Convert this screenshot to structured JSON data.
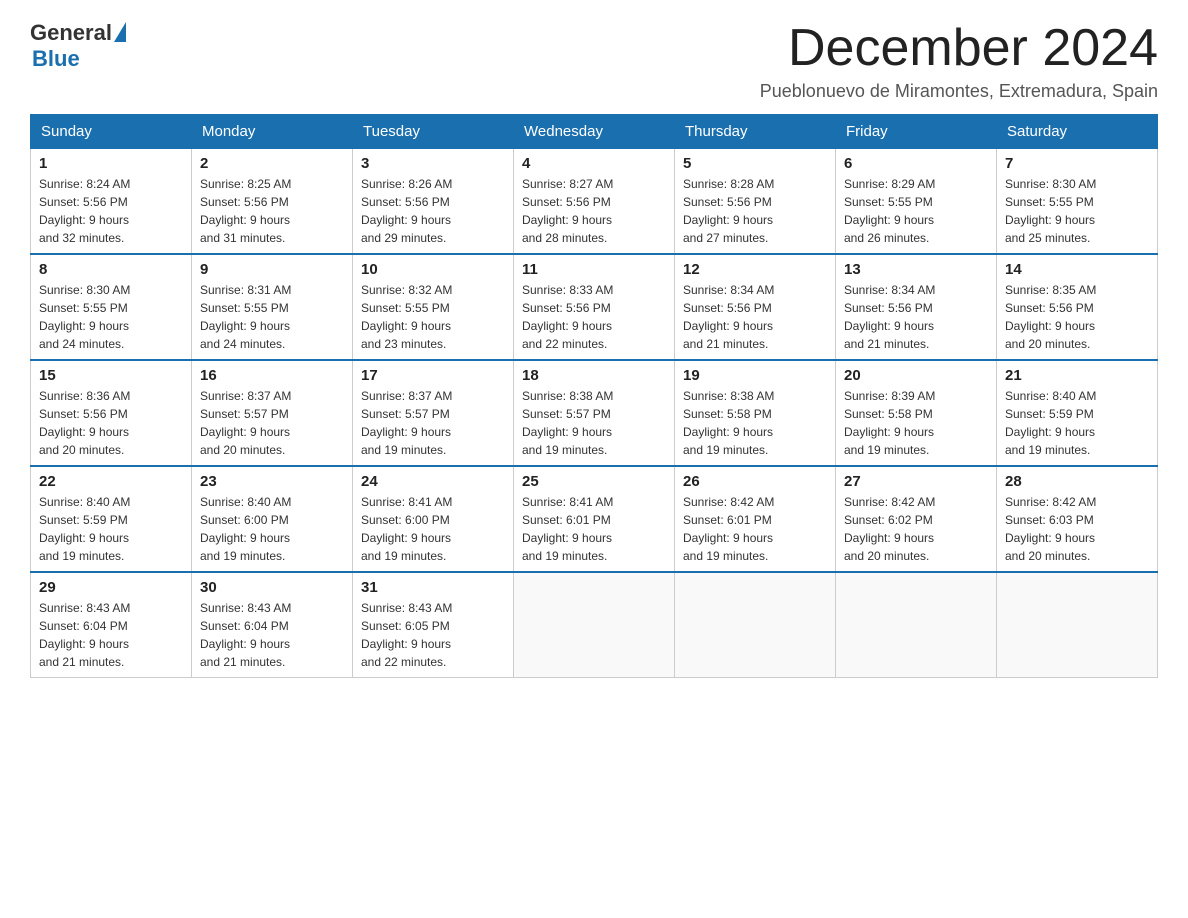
{
  "logo": {
    "general": "General",
    "blue": "Blue"
  },
  "title": "December 2024",
  "subtitle": "Pueblonuevo de Miramontes, Extremadura, Spain",
  "days_of_week": [
    "Sunday",
    "Monday",
    "Tuesday",
    "Wednesday",
    "Thursday",
    "Friday",
    "Saturday"
  ],
  "weeks": [
    [
      {
        "day": "1",
        "sunrise": "8:24 AM",
        "sunset": "5:56 PM",
        "daylight": "9 hours and 32 minutes."
      },
      {
        "day": "2",
        "sunrise": "8:25 AM",
        "sunset": "5:56 PM",
        "daylight": "9 hours and 31 minutes."
      },
      {
        "day": "3",
        "sunrise": "8:26 AM",
        "sunset": "5:56 PM",
        "daylight": "9 hours and 29 minutes."
      },
      {
        "day": "4",
        "sunrise": "8:27 AM",
        "sunset": "5:56 PM",
        "daylight": "9 hours and 28 minutes."
      },
      {
        "day": "5",
        "sunrise": "8:28 AM",
        "sunset": "5:56 PM",
        "daylight": "9 hours and 27 minutes."
      },
      {
        "day": "6",
        "sunrise": "8:29 AM",
        "sunset": "5:55 PM",
        "daylight": "9 hours and 26 minutes."
      },
      {
        "day": "7",
        "sunrise": "8:30 AM",
        "sunset": "5:55 PM",
        "daylight": "9 hours and 25 minutes."
      }
    ],
    [
      {
        "day": "8",
        "sunrise": "8:30 AM",
        "sunset": "5:55 PM",
        "daylight": "9 hours and 24 minutes."
      },
      {
        "day": "9",
        "sunrise": "8:31 AM",
        "sunset": "5:55 PM",
        "daylight": "9 hours and 24 minutes."
      },
      {
        "day": "10",
        "sunrise": "8:32 AM",
        "sunset": "5:55 PM",
        "daylight": "9 hours and 23 minutes."
      },
      {
        "day": "11",
        "sunrise": "8:33 AM",
        "sunset": "5:56 PM",
        "daylight": "9 hours and 22 minutes."
      },
      {
        "day": "12",
        "sunrise": "8:34 AM",
        "sunset": "5:56 PM",
        "daylight": "9 hours and 21 minutes."
      },
      {
        "day": "13",
        "sunrise": "8:34 AM",
        "sunset": "5:56 PM",
        "daylight": "9 hours and 21 minutes."
      },
      {
        "day": "14",
        "sunrise": "8:35 AM",
        "sunset": "5:56 PM",
        "daylight": "9 hours and 20 minutes."
      }
    ],
    [
      {
        "day": "15",
        "sunrise": "8:36 AM",
        "sunset": "5:56 PM",
        "daylight": "9 hours and 20 minutes."
      },
      {
        "day": "16",
        "sunrise": "8:37 AM",
        "sunset": "5:57 PM",
        "daylight": "9 hours and 20 minutes."
      },
      {
        "day": "17",
        "sunrise": "8:37 AM",
        "sunset": "5:57 PM",
        "daylight": "9 hours and 19 minutes."
      },
      {
        "day": "18",
        "sunrise": "8:38 AM",
        "sunset": "5:57 PM",
        "daylight": "9 hours and 19 minutes."
      },
      {
        "day": "19",
        "sunrise": "8:38 AM",
        "sunset": "5:58 PM",
        "daylight": "9 hours and 19 minutes."
      },
      {
        "day": "20",
        "sunrise": "8:39 AM",
        "sunset": "5:58 PM",
        "daylight": "9 hours and 19 minutes."
      },
      {
        "day": "21",
        "sunrise": "8:40 AM",
        "sunset": "5:59 PM",
        "daylight": "9 hours and 19 minutes."
      }
    ],
    [
      {
        "day": "22",
        "sunrise": "8:40 AM",
        "sunset": "5:59 PM",
        "daylight": "9 hours and 19 minutes."
      },
      {
        "day": "23",
        "sunrise": "8:40 AM",
        "sunset": "6:00 PM",
        "daylight": "9 hours and 19 minutes."
      },
      {
        "day": "24",
        "sunrise": "8:41 AM",
        "sunset": "6:00 PM",
        "daylight": "9 hours and 19 minutes."
      },
      {
        "day": "25",
        "sunrise": "8:41 AM",
        "sunset": "6:01 PM",
        "daylight": "9 hours and 19 minutes."
      },
      {
        "day": "26",
        "sunrise": "8:42 AM",
        "sunset": "6:01 PM",
        "daylight": "9 hours and 19 minutes."
      },
      {
        "day": "27",
        "sunrise": "8:42 AM",
        "sunset": "6:02 PM",
        "daylight": "9 hours and 20 minutes."
      },
      {
        "day": "28",
        "sunrise": "8:42 AM",
        "sunset": "6:03 PM",
        "daylight": "9 hours and 20 minutes."
      }
    ],
    [
      {
        "day": "29",
        "sunrise": "8:43 AM",
        "sunset": "6:04 PM",
        "daylight": "9 hours and 21 minutes."
      },
      {
        "day": "30",
        "sunrise": "8:43 AM",
        "sunset": "6:04 PM",
        "daylight": "9 hours and 21 minutes."
      },
      {
        "day": "31",
        "sunrise": "8:43 AM",
        "sunset": "6:05 PM",
        "daylight": "9 hours and 22 minutes."
      },
      null,
      null,
      null,
      null
    ]
  ],
  "labels": {
    "sunrise": "Sunrise:",
    "sunset": "Sunset:",
    "daylight": "Daylight:"
  }
}
